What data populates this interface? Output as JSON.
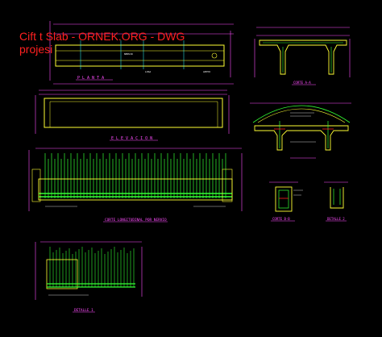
{
  "watermark": {
    "line1": "Cift t Slab - ORNEK.ORG - DWG",
    "line2": "projesi"
  },
  "labels": {
    "planta": "P L A N T A",
    "elevacion": "E L E V A C I O N",
    "corte_long": "CORTE LONGITUDINAL POR NERVIO",
    "detalle1": "DETALLE 1",
    "corte_aa": "CORTE A-A",
    "corte_bb": "CORTE B-B",
    "detalle2": "DETALLE 2"
  },
  "colors": {
    "background": "#000000",
    "outline": "#ffff33",
    "dimension": "#ff4dff",
    "rebar": "#33ff33",
    "text": "#ffffff",
    "watermark": "#ff2020",
    "cyan": "#33ffff"
  }
}
